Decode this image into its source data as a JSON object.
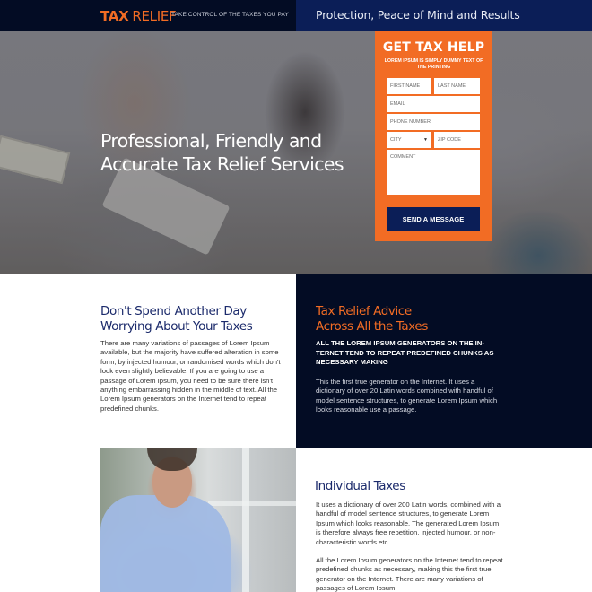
{
  "header": {
    "logo_bold": "TAX",
    "logo_light": "RELIEF",
    "tagline": "TAKE CONTROL OF THE TAXES YOU PAY",
    "slogan": "Protection, Peace of Mind and Results"
  },
  "hero": {
    "title_line1": "Professional, Friendly and",
    "title_line2": "Accurate Tax Relief Services"
  },
  "form": {
    "title": "GET TAX HELP",
    "subtitle": "LOREM IPSUM IS SIMPLY DUMMY TEXT OF THE PRINTING",
    "first_name_placeholder": "FIRST NAME",
    "last_name_placeholder": "LAST NAME",
    "email_placeholder": "EMAIL",
    "phone_placeholder": "PHONE NUMBER",
    "city_selected": "CITY",
    "zip_placeholder": "ZIP CODE",
    "comment_placeholder": "COMMENT",
    "submit_label": "SEND A MESSAGE"
  },
  "section_worry": {
    "heading_line1": "Don't Spend Another Day",
    "heading_line2": "Worrying About Your Taxes",
    "body": "There are many variations of passages of Lorem Ipsum available, but the majority have suffered alteration in some form, by injected humour, or randomised words which don't look even slightly believable. If you are going to use a passage of Lorem Ipsum, you need to be sure there isn't anything embarrassing hidden in the middle of text. All the Lorem Ipsum generators on the Internet tend to repeat predefined chunks."
  },
  "section_advice": {
    "heading_line1": "Tax Relief Advice",
    "heading_line2": "Across All the Taxes",
    "subheading": "ALL THE LOREM IPSUM GENERATORS ON THE IN- TERNET TEND TO REPEAT PREDEFINED CHUNKS AS NECESSARY MAKING",
    "body": "This the first true generator on the Internet. It uses a dictionary of over 20 Latin words combined with handful of model sentence structures, to generate Lorem Ipsum which looks reasonable use a passage."
  },
  "section_individual": {
    "heading": "Individual Taxes",
    "paragraph1": "It uses a dictionary of over 200 Latin words, combined with a handful of model sentence structures, to generate Lorem Ipsum which looks reasonable. The generated Lorem Ipsum is therefore always free repetition, injected humour, or non-characteristic words etc.",
    "paragraph2": "All the Lorem Ipsum generators on the Internet tend to repeat predefined chunks as necessary, making this the first true generator on the Internet. There are many variations of passages of Lorem Ipsum."
  },
  "colors": {
    "brand_orange": "#f26c24",
    "navy_dark": "#030c24",
    "navy": "#0b1e57",
    "heading_blue": "#1b2a6b"
  }
}
